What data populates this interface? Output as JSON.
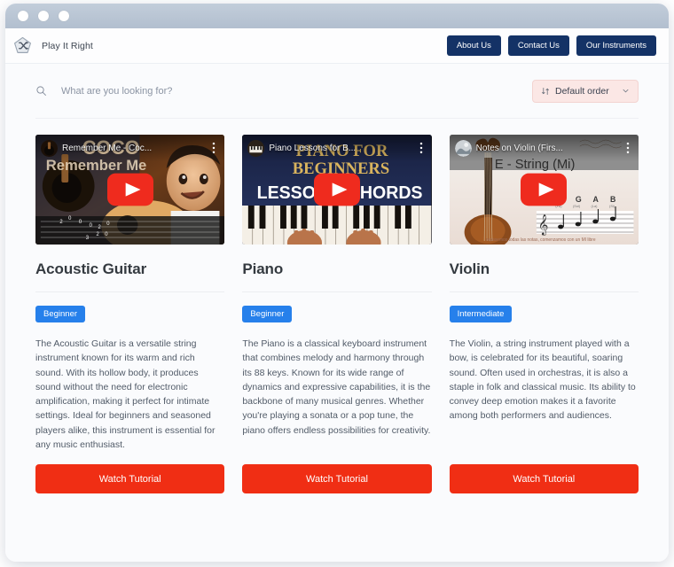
{
  "window": {
    "traffic_lights": [
      "close",
      "minimize",
      "maximize"
    ]
  },
  "header": {
    "logo_icon": "shuffle-pentagon-logo",
    "brand_name": "Play It Right",
    "nav": [
      {
        "label": "About Us"
      },
      {
        "label": "Contact Us"
      },
      {
        "label": "Our Instruments"
      }
    ]
  },
  "toolbar": {
    "search": {
      "icon": "search-icon",
      "placeholder": "What are you looking for?",
      "value": ""
    },
    "sort": {
      "icon": "sort-arrows-icon",
      "selected": "Default order",
      "chevron": "chevron-down-icon",
      "options": [
        "Default order"
      ]
    }
  },
  "colors": {
    "nav_button": "#143266",
    "badge_blue": "#2680eb",
    "watch_button_red": "#f02e14",
    "sort_background": "#fbe7e5",
    "page_background": "#fafbfd",
    "titlebar": "#b8c4d2"
  },
  "cards": [
    {
      "title": "Acoustic Guitar",
      "badge": "Beginner",
      "description": "The Acoustic Guitar is a versatile string instrument known for its warm and rich sound. With its hollow body, it produces sound without the need for electronic amplification, making it perfect for intimate settings. Ideal for beginners and seasoned players alike, this instrument is essential for any music enthusiast.",
      "button": "Watch Tutorial",
      "video": {
        "title": "Remember Me - Coc...",
        "overlay_text_primary": "COCO",
        "overlay_text_secondary": "Remember Me",
        "play_icon": "youtube-play-icon",
        "menu_icon": "kebab-menu-icon",
        "channel_icon": "channel-avatar"
      }
    },
    {
      "title": "Piano",
      "badge": "Beginner",
      "description": "The Piano is a classical keyboard instrument that combines melody and harmony through its 88 keys. Known for its wide range of dynamics and expressive capabilities, it is the backbone of many musical genres. Whether you're playing a sonata or a pop tune, the piano offers endless possibilities for creativity.",
      "button": "Watch Tutorial",
      "video": {
        "title": "Piano Lessons for B...",
        "overlay_text_primary": "PIANO FOR",
        "overlay_text_secondary": "BEGINNERS",
        "overlay_text_tertiary": "LESSON 1 CHORDS",
        "play_icon": "youtube-play-icon",
        "menu_icon": "kebab-menu-icon",
        "channel_icon": "channel-avatar"
      }
    },
    {
      "title": "Violin",
      "badge": "Intermediate",
      "description": "The Violin, a string instrument played with a bow, is celebrated for its beautiful, soaring sound. Often used in orchestras, it is also a staple in folk and classical music. Its ability to convey deep emotion makes it a favorite among both performers and audiences.",
      "button": "Watch Tutorial",
      "video": {
        "title": "Notes on Violin (Firs...",
        "overlay_text_primary": "E - String (Mi)",
        "note_labels": [
          "F",
          "G",
          "A",
          "B"
        ],
        "note_sublabels": [
          "(Fa)",
          "(Sol)",
          "(La)",
          "(Si)"
        ],
        "caption": "repasemos todas las notas, comenzamos con un MI libre",
        "play_icon": "youtube-play-icon",
        "menu_icon": "kebab-menu-icon",
        "channel_icon": "channel-avatar"
      }
    }
  ]
}
